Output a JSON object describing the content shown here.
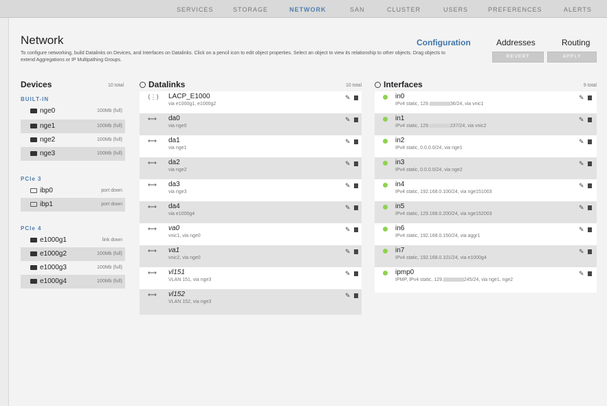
{
  "topnav": [
    "SERVICES",
    "STORAGE",
    "NETWORK",
    "SAN",
    "CLUSTER",
    "USERS",
    "PREFERENCES",
    "ALERTS"
  ],
  "page_title": "Network",
  "subtabs": [
    "Configuration",
    "Addresses",
    "Routing"
  ],
  "description": "To configure networking, build Datalinks on Devices, and Interfaces on Datalinks. Click on a pencil icon to edit object properties. Select an object to view its relationship to other objects. Drag objects to extend Aggregations or IP Multipathing Groups.",
  "buttons": {
    "revert": "REVERT",
    "apply": "APPLY"
  },
  "devices": {
    "header": "Devices",
    "total": "10 total",
    "sections": [
      {
        "label": "BUILT-IN",
        "items": [
          {
            "name": "nge0",
            "status": "100Mb (full)"
          },
          {
            "name": "nge1",
            "status": "100Mb (full)"
          },
          {
            "name": "nge2",
            "status": "100Mb (full)"
          },
          {
            "name": "nge3",
            "status": "100Mb (full)"
          }
        ]
      },
      {
        "label": "PCIe 3",
        "items": [
          {
            "name": "ibp0",
            "status": "port down"
          },
          {
            "name": "ibp1",
            "status": "port down"
          }
        ]
      },
      {
        "label": "PCIe 4",
        "items": [
          {
            "name": "e1000g1",
            "status": "link down"
          },
          {
            "name": "e1000g2",
            "status": "100Mb (full)"
          },
          {
            "name": "e1000g3",
            "status": "100Mb (full)"
          },
          {
            "name": "e1000g4",
            "status": "100Mb (full)"
          }
        ]
      }
    ]
  },
  "datalinks": {
    "header": "Datalinks",
    "total": "10 total",
    "items": [
      {
        "name": "LACP_E1000",
        "sub": "via e1000g1, e1000g2"
      },
      {
        "name": "da0",
        "sub": "via nge0"
      },
      {
        "name": "da1",
        "sub": "via nge1"
      },
      {
        "name": "da2",
        "sub": "via nge2"
      },
      {
        "name": "da3",
        "sub": "via nge3"
      },
      {
        "name": "da4",
        "sub": "via e1000g4"
      },
      {
        "name": "va0",
        "sub": "vnic1, via nge0"
      },
      {
        "name": "va1",
        "sub": "vnic2, via nge0"
      },
      {
        "name": "vl151",
        "sub": "VLAN 151, via nge3"
      },
      {
        "name": "vl152",
        "sub": "VLAN 152, via nge3"
      }
    ]
  },
  "interfaces": {
    "header": "Interfaces",
    "total": "9 total",
    "items": [
      {
        "name": "in0",
        "sub_a": "IPv4 static, 129.",
        "sub_b": "36/24, via vnic1"
      },
      {
        "name": "in1",
        "sub_a": "IPv4 static, 129.",
        "sub_b": "237/24, via vnic2"
      },
      {
        "name": "in2",
        "sub_a": "IPv4 static, 0.0.0.0/24, via nge1",
        "sub_b": ""
      },
      {
        "name": "in3",
        "sub_a": "IPv4 static, 0.0.0.0/24, via nge2",
        "sub_b": ""
      },
      {
        "name": "in4",
        "sub_a": "IPv4 static, 192.168.0.100/24, via nge151003",
        "sub_b": ""
      },
      {
        "name": "in5",
        "sub_a": "IPv4 static, 129.168.0.200/24, via nge152003",
        "sub_b": ""
      },
      {
        "name": "in6",
        "sub_a": "IPv4 static, 192.168.0.150/24, via aggr1",
        "sub_b": ""
      },
      {
        "name": "in7",
        "sub_a": "IPv4 static, 192.168.0.101/24, via e1000g4",
        "sub_b": ""
      },
      {
        "name": "ipmp0",
        "sub_a": "IPMP, IPv4 static, 129.",
        "sub_b": "245/24, via nge1, nge2"
      }
    ]
  },
  "icons": {
    "edit": "pencil-icon",
    "delete": "trash-icon",
    "add": "add-circle-icon",
    "link": "link-arrow-icon",
    "status": "status-dot-icon"
  },
  "colors": {
    "accent": "#4f7dae",
    "status_up": "#8fd14f"
  }
}
